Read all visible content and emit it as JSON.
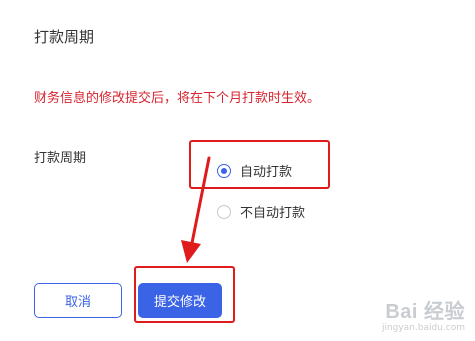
{
  "page_title": "打款周期",
  "notice": "财务信息的修改提交后，将在下个月打款时生效。",
  "payment_cycle": {
    "label": "打款周期",
    "options": [
      {
        "label": "自动打款",
        "checked": true
      },
      {
        "label": "不自动打款",
        "checked": false
      }
    ]
  },
  "actions": {
    "cancel_label": "取消",
    "submit_label": "提交修改"
  },
  "watermark": {
    "logo": "Bai 经验",
    "url": "jingyan.baidu.com"
  },
  "colors": {
    "primary": "#3b63e6",
    "notice": "#d8242f",
    "annotation": "#e01b1b"
  }
}
